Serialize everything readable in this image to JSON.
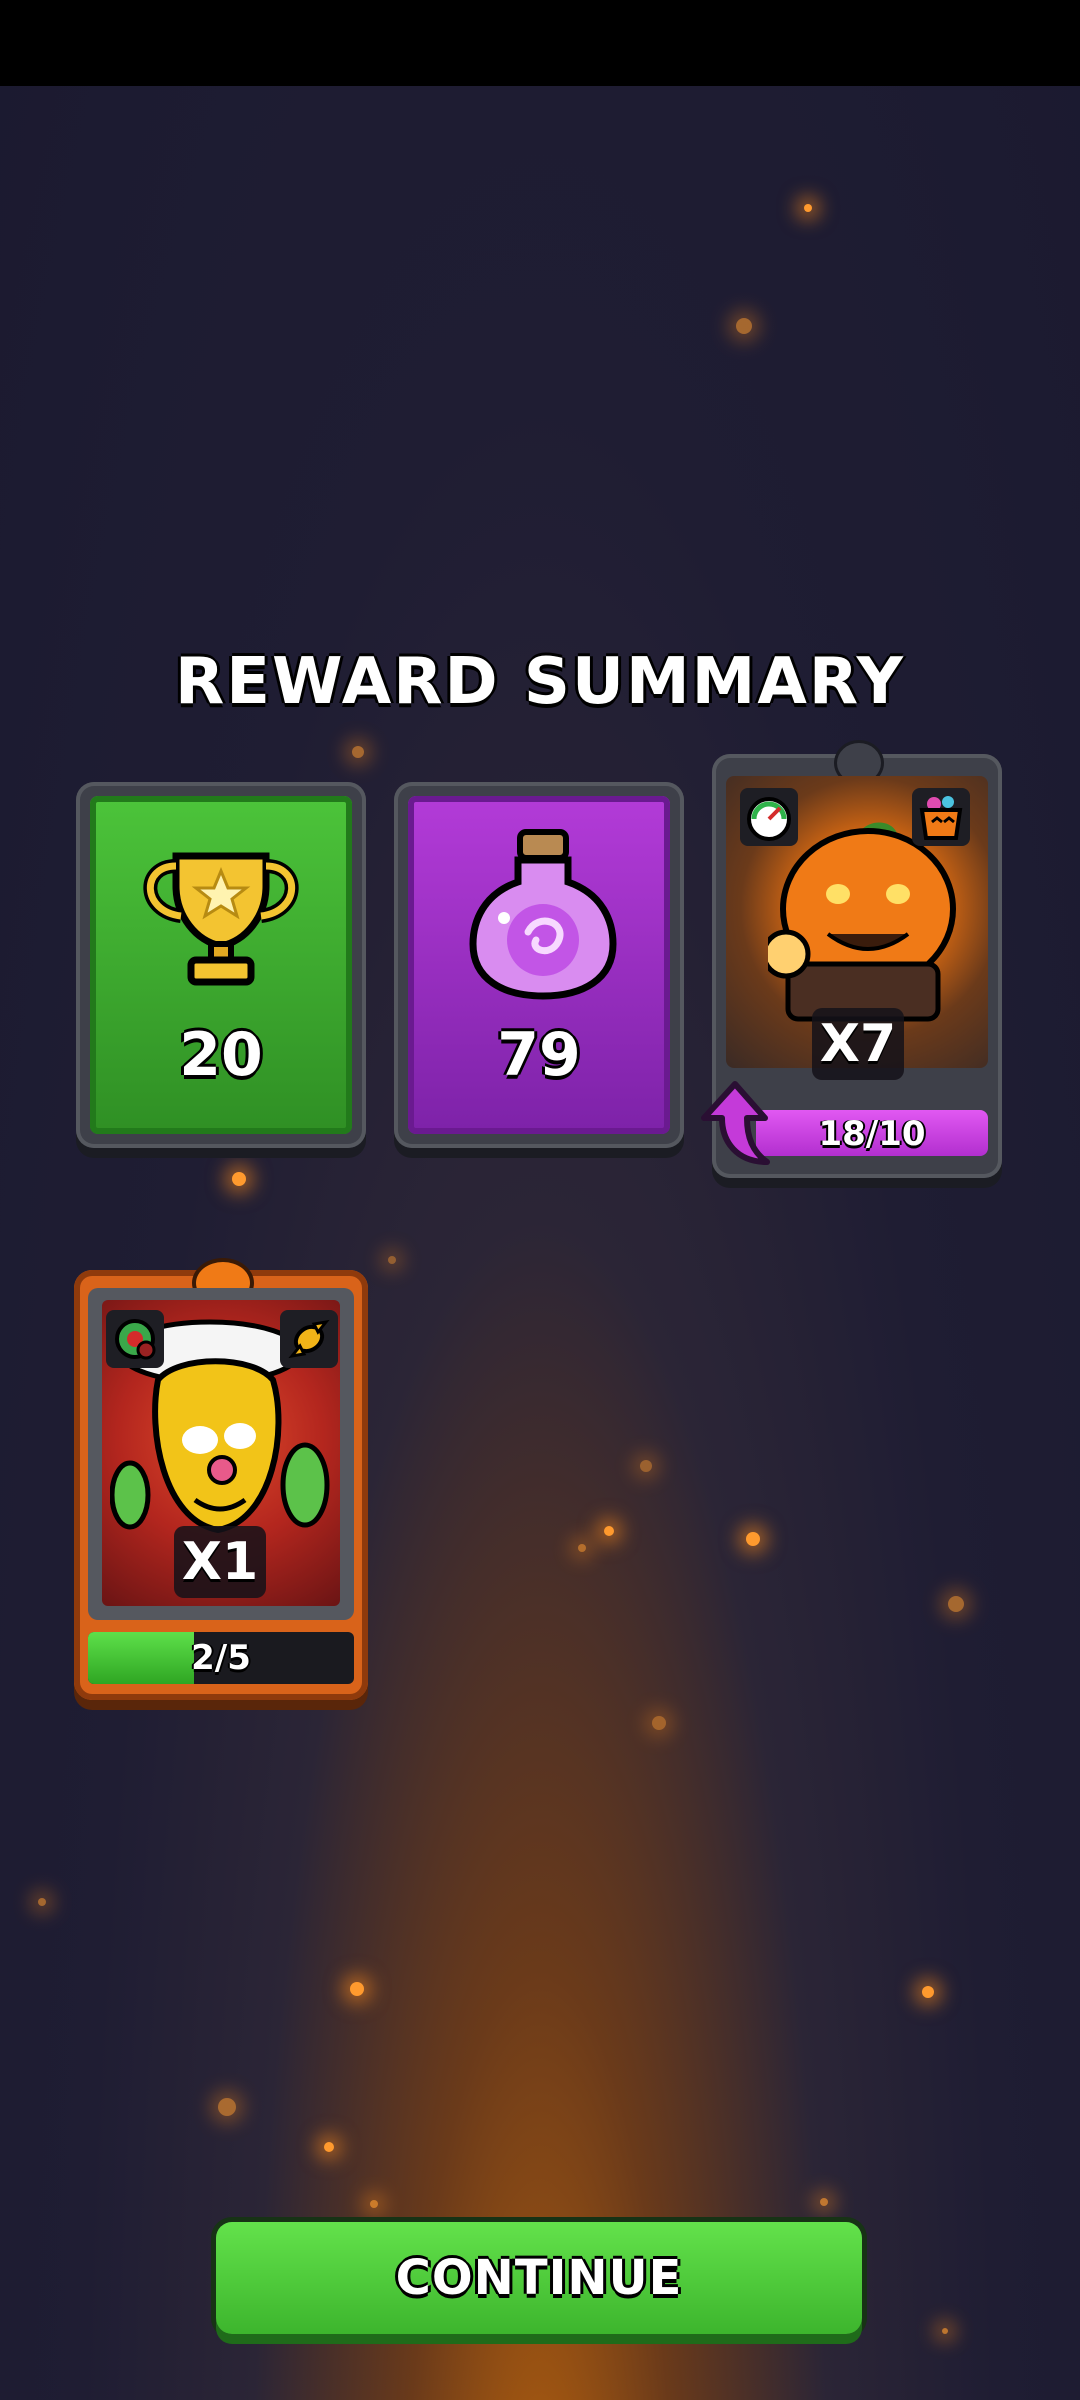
{
  "title": "REWARD SUMMARY",
  "rewards": {
    "trophies": {
      "icon": "trophy-icon",
      "amount": "20",
      "color": "#3fa62f"
    },
    "potion": {
      "icon": "potion-icon",
      "amount": "79",
      "color": "#9b2fc4"
    }
  },
  "cards": [
    {
      "name": "pumpkin-monster-card",
      "multiplier": "X7",
      "progress": "18/10",
      "progress_fraction": 1.0,
      "frame_color": "#3e4049",
      "bar_color": "#c43ad9"
    },
    {
      "name": "pepper-clown-card",
      "multiplier": "X1",
      "progress": "2/5",
      "progress_fraction": 0.4,
      "frame_color": "#d9631a",
      "bar_color": "#3fc12e"
    }
  ],
  "continue_label": "CONTINUE"
}
